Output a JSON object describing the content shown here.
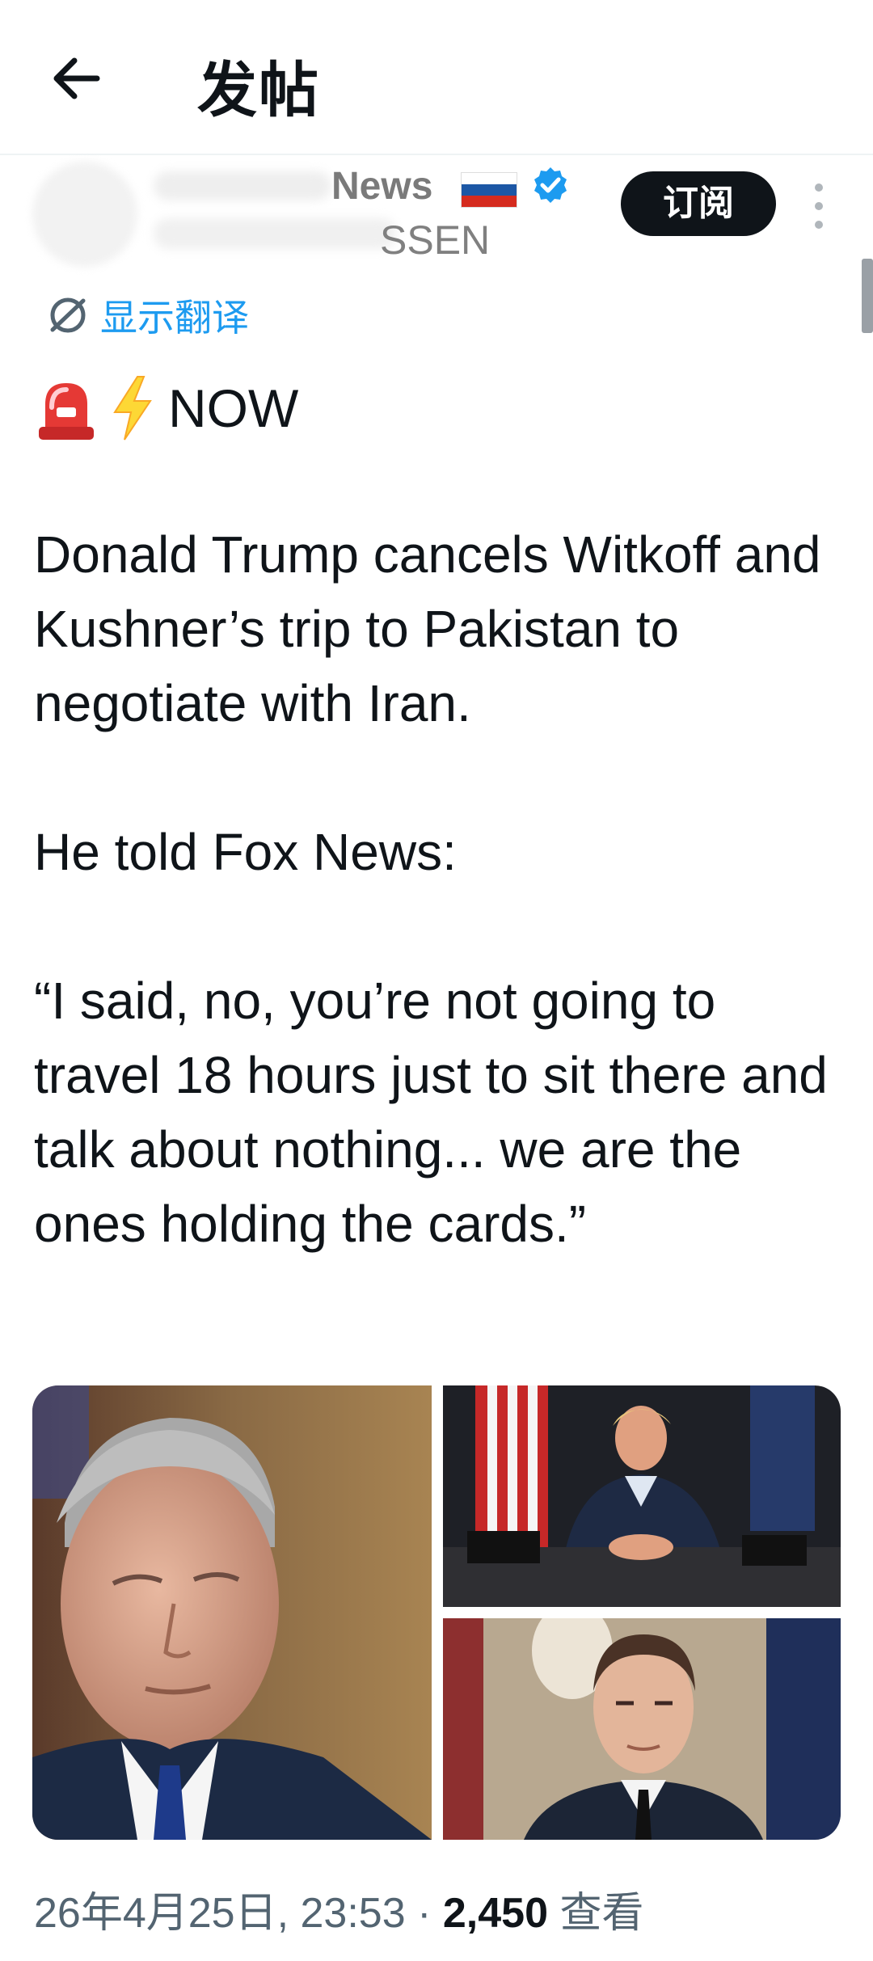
{
  "header": {
    "title": "发帖",
    "back_icon": "arrow-left-icon"
  },
  "author": {
    "name_visible": "News",
    "handle_visible": "SSEN",
    "flag": "russia-flag",
    "verified": true,
    "subscribe_label": "订阅",
    "more_icon": "more-vertical-icon"
  },
  "translate": {
    "label": "显示翻译",
    "icon": "translate-icon"
  },
  "tweet": {
    "headline_emoji": [
      "rotating-light-icon",
      "high-voltage-icon"
    ],
    "headline": "NOW",
    "paragraphs": [
      "Donald Trump cancels Witkoff and Kushner’s trip to Pakistan to negotiate with Iran.",
      "He told Fox News:",
      "“I said, no, you’re not going to travel 18 hours just to sit there and talk about nothing... we are the ones holding the cards.”"
    ]
  },
  "media": {
    "photos": [
      {
        "name": "photo-1"
      },
      {
        "name": "photo-2"
      },
      {
        "name": "photo-3"
      }
    ]
  },
  "meta": {
    "timestamp": "26年4月25日, 23:53",
    "separator": "·",
    "views": "2,450",
    "views_label": "查看"
  },
  "colors": {
    "accent": "#1d9bf0",
    "text": "#0f1419",
    "secondary": "#536471"
  }
}
